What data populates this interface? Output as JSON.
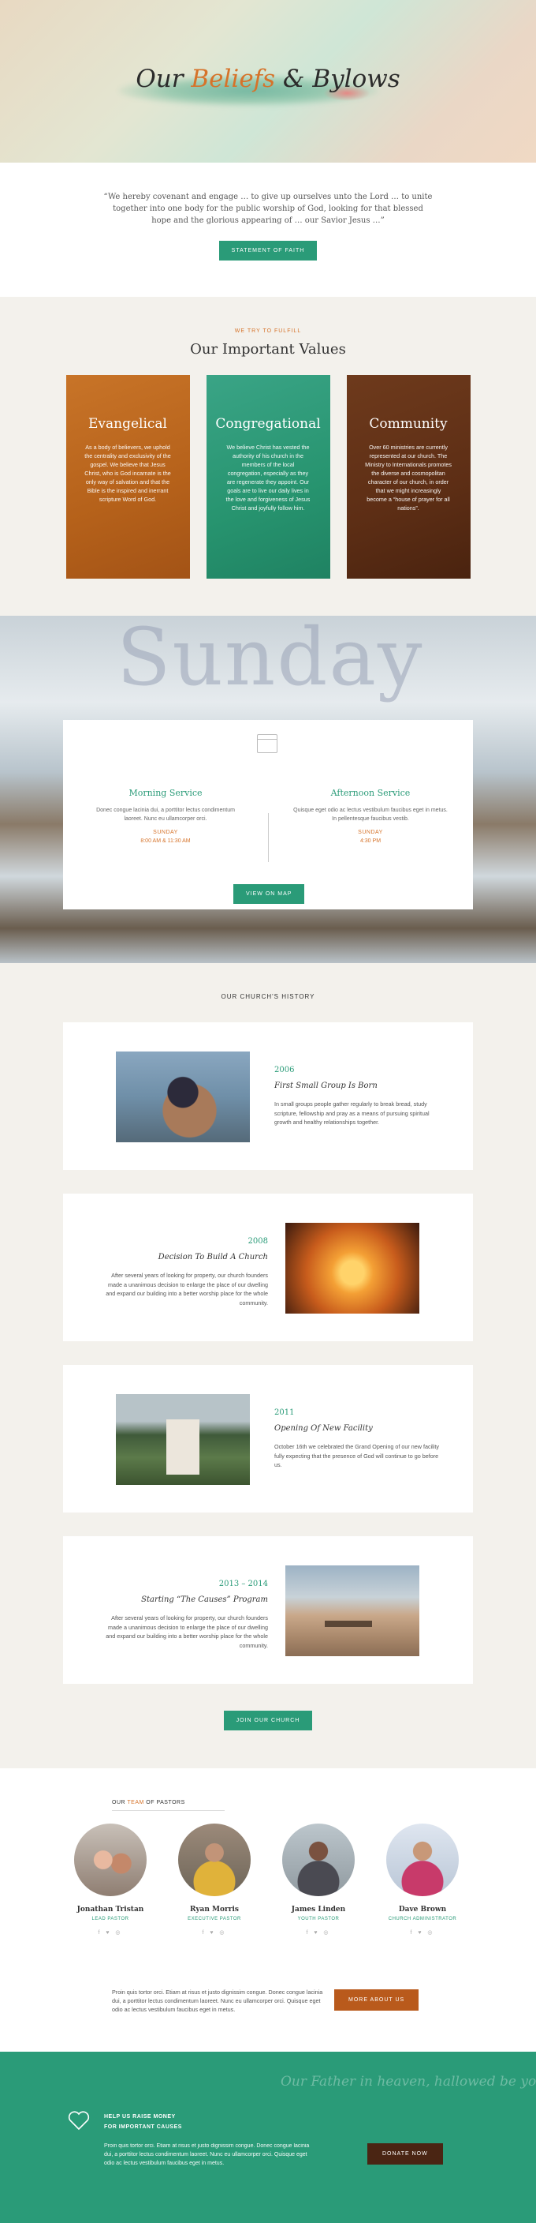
{
  "hero": {
    "title_pre": "Our ",
    "title_accent": "Beliefs",
    "title_post": " & Bylows"
  },
  "quote": {
    "text": "“We hereby covenant and engage … to give up ourselves unto the Lord … to unite together into one body for the public worship of God, looking for that blessed hope and the glorious appearing of … our Savior Jesus …”",
    "button": "Statement of Faith"
  },
  "values": {
    "eyebrow": "We try to fulfill",
    "title": "Our Important Values",
    "cards": [
      {
        "title": "Evangelical",
        "text": "As a body of believers, we uphold the centrality and exclusivity of the gospel. We believe that Jesus Christ, who is God incarnate is the only way of salvation and that the Bible is the inspired and inerrant scripture Word of God."
      },
      {
        "title": "Congregational",
        "text": "We believe Christ has vested the authority of his church in the members of the local congregation, especially as they are regenerate they appoint. Our goals are to live our daily lives in the love and forgiveness of Jesus Christ and joyfully follow him."
      },
      {
        "title": "Community",
        "text": "Over 60 ministries are currently represented at our church. The Ministry to Internationals promotes the diverse and cosmopolitan character of our church, in order that we might increasingly become a “house of prayer for all nations”."
      }
    ]
  },
  "sunday": {
    "ghost_word": "Sunday",
    "morning": {
      "title": "Morning Service",
      "text": "Donec congue lacinia dui, a porttitor lectus condimentum laoreet. Nunc eu ullamcorper orci.",
      "day": "SUNDAY",
      "time": "8:00 AM & 11:30 AM"
    },
    "afternoon": {
      "title": "Afternoon Service",
      "text": "Quisque eget odio ac lectus vestibulum faucibus eget in metus. In pellentesque faucibus vestib.",
      "day": "SUNDAY",
      "time": "4:30 PM"
    },
    "button": "View on Map"
  },
  "history": {
    "title": "Our Church's History",
    "items": [
      {
        "year": "2006",
        "heading": "First Small Group Is Born",
        "text": "In small groups people gather regularly to break bread, study scripture, fellowship and pray as a means of pursuing spiritual growth and healthy relationships together."
      },
      {
        "year": "2008",
        "heading": "Decision To Build A Church",
        "text": "After several years of looking for property, our church founders made a unanimous decision to enlarge the place of our dwelling and expand our building into a better worship place for the whole community."
      },
      {
        "year": "2011",
        "heading": "Opening Of New Facility",
        "text": "October 16th we celebrated the Grand Opening of our new facility fully expecting that the presence of God will continue to go before us."
      },
      {
        "year": "2013 – 2014",
        "heading": "Starting “The Causes” Program",
        "text": "After several years of looking for property, our church founders made a unanimous decision to enlarge the place of our dwelling and expand our building into a better worship place for the whole community."
      }
    ],
    "button": "Join Our Church"
  },
  "pastors": {
    "head_pre": "Our ",
    "head_accent": "team",
    "head_post": " of Pastors",
    "list": [
      {
        "name": "Jonathan Tristan",
        "role": "Lead Pastor"
      },
      {
        "name": "Ryan Morris",
        "role": "Executive Pastor"
      },
      {
        "name": "James Linden",
        "role": "Youth Pastor"
      },
      {
        "name": "Dave Brown",
        "role": "Church Administrator"
      }
    ],
    "social": "f ♥ ◎",
    "about_text": "Proin quis tortor orci. Etiam at risus et justo dignissim congue. Donec congue lacinia dui, a porttitor lectus condimentum laoreet. Nunc eu ullamcorper orci. Quisque eget odio ac lectus vestibulum faucibus eget in metus.",
    "about_button": "More About Us"
  },
  "donate": {
    "script": "Our Father in heaven, hallowed be your",
    "title_line1": "Help us raise money",
    "title_line2": "for important causes",
    "text": "Proin quis tortor orci. Etiam at risus et justo dignissim congue. Donec congue lacinia dui, a porttitor lectus condimentum laoreet. Nunc eu ullamcorper orci. Quisque eget odio ac lectus vestibulum faucibus eget in metus.",
    "button": "Donate Now"
  },
  "colors": {
    "accent_green": "#2a9b78",
    "accent_orange": "#d6732a",
    "brown": "#4a2513"
  }
}
